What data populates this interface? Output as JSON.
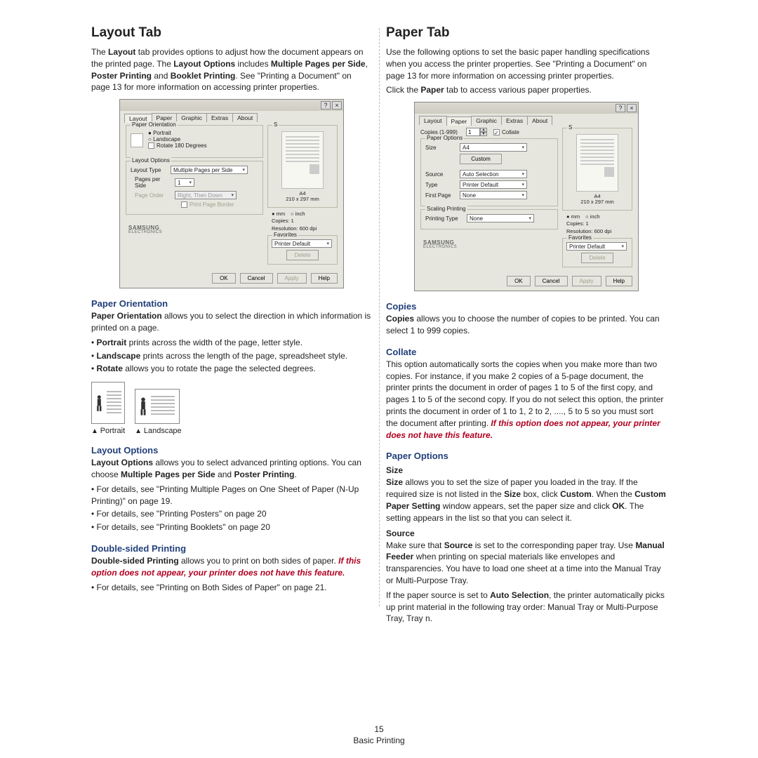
{
  "footer": {
    "page": "15",
    "section": "Basic Printing"
  },
  "left": {
    "h2": "Layout Tab",
    "intro1": "The ",
    "layout_b": "Layout",
    "intro2": " tab provides options to adjust how the document appears on the printed page. The ",
    "lo_b": "Layout Options",
    "intro3": " includes ",
    "mpps": "Multiple Pages per Side",
    "comma": ",  ",
    "poster": "Poster Printing",
    "and": " and ",
    "booklet": "Booklet Printing",
    "intro4": ". See \"Printing a Document\" on page 13 for more information on accessing printer properties.",
    "paper_orientation": {
      "h3": "Paper Orientation",
      "line1a": "Paper Orientation",
      "line1b": " allows you to select the direction in which information is printed on a page.",
      "b_portrait": "Portrait",
      "b_portrait_t": " prints across the width of the page, letter style.",
      "b_landscape": "Landscape",
      "b_landscape_t": " prints across the length of the page, spreadsheet style.",
      "b_rotate": "Rotate",
      "b_rotate_t": " allows you to rotate the page the selected degrees.",
      "cap_portrait": "Portrait",
      "cap_landscape": "Landscape"
    },
    "layout_options": {
      "h3": "Layout Options",
      "line1a": "Layout Options",
      "line1b": " allows you to select advanced printing options. You can choose ",
      "mpps": "Multiple Pages per Side",
      "and": " and ",
      "poster": "Poster Printing",
      "period": ".",
      "li1": "For details, see \"Printing Multiple Pages on One Sheet of Paper (N-Up Printing)\" on page 19.",
      "li2": "For details, see \"Printing Posters\" on page 20",
      "li3": "For details, see \"Printing Booklets\" on page 20"
    },
    "dsp": {
      "h3": "Double-sided Printing",
      "b": "Double-sided Printing",
      "t1": " allows you to print on both sides of paper. ",
      "note": "If this option does not appear, your printer does not have this feature.",
      "li1": "For details, see \"Printing on Both Sides of Paper\" on page 21."
    }
  },
  "right": {
    "h2": "Paper Tab",
    "intro": "Use the following options to set the basic paper handling specifications when you access the printer properties. See \"Printing a Document\" on page 13 for more information on accessing printer properties.",
    "click1": "Click the ",
    "click_b": "Paper",
    "click2": " tab to access various paper properties.",
    "copies": {
      "h3": "Copies",
      "b": "Copies",
      "t": " allows you to choose the number of copies to be printed. You can select 1 to 999 copies."
    },
    "collate": {
      "h3": "Collate",
      "t": "This option automatically sorts the copies when you make more than two copies. For instance, if you make 2 copies of a 5-page document, the printer prints the document in order of pages 1 to 5 of the first copy, and pages 1 to 5 of the second copy. If you do not select this option, the printer prints the document in order of 1 to 1, 2 to 2, ...., 5 to 5 so you must sort the document after printing. ",
      "note": "If this option does not appear, your printer does not have this feature."
    },
    "po": {
      "h3": "Paper Options"
    },
    "size": {
      "h4": "Size",
      "b": "Size",
      "t1": " allows you to set the size of paper you loaded in the tray. If the required size is not listed in the ",
      "sizeb": "Size",
      "t2": " box, click ",
      "custom": "Custom",
      "t3": ". When the ",
      "cps": "Custom Paper Setting",
      "t4": " window appears, set the paper size and click ",
      "ok": "OK",
      "t5": ". The setting appears in the list so that you can select it."
    },
    "source": {
      "h4": "Source",
      "t1": "Make sure that ",
      "b1": "Source",
      "t2": " is set to the corresponding paper tray. Use ",
      "b2": "Manual Feeder",
      "t3": " when printing on special materials like envelopes and transparencies. You have to load one sheet at a time into the Manual Tray or Multi-Purpose Tray.",
      "t4": "If the paper source is set to ",
      "b3": "Auto Selection",
      "t5": ", the printer automatically picks up print material in the following tray order: Manual Tray or Multi-Purpose Tray, Tray n."
    }
  },
  "dlg": {
    "tabs": [
      "Layout",
      "Paper",
      "Graphic",
      "Extras",
      "About"
    ],
    "layout": {
      "group_po": "Paper Orientation",
      "portrait": "Portrait",
      "landscape": "Landscape",
      "rotate": "Rotate 180 Degrees",
      "group_lo": "Layout Options",
      "layout_type": "Layout Type",
      "layout_type_v": "Multiple Pages per Side",
      "pps": "Pages per Side",
      "pps_v": "1",
      "page_order": "Page Order",
      "page_order_v": "Right, Then Down",
      "ppb": "Print Page Border"
    },
    "paper": {
      "copies": "Copies (1-999)",
      "copies_v": "1",
      "collate": "Collate",
      "group_po": "Paper Options",
      "size": "Size",
      "size_v": "A4",
      "custom": "Custom",
      "source": "Source",
      "source_v": "Auto Selection",
      "type": "Type",
      "type_v": "Printer Default",
      "first": "First Page",
      "first_v": "None",
      "group_sp": "Scaling Printing",
      "ptype": "Printing Type",
      "ptype_v": "None"
    },
    "preview": {
      "label": "S",
      "sheet": "A4",
      "dims": "210 x 297 mm",
      "mm": "mm",
      "inch": "inch",
      "copies": "Copies: 1",
      "res": "Resolution: 600 dpi",
      "fav": "Favorites",
      "fav_v": "Printer Default",
      "del": "Delete"
    },
    "logo": {
      "brand": "SAMSUNG",
      "sub": "ELECTRONICS"
    },
    "buttons": {
      "ok": "OK",
      "cancel": "Cancel",
      "apply": "Apply",
      "help": "Help"
    }
  }
}
